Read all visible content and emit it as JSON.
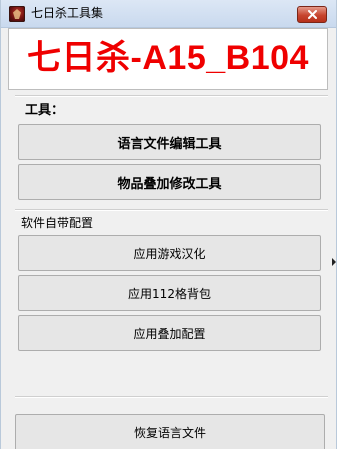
{
  "window": {
    "title": "七日杀工具集",
    "close_icon": "close-icon"
  },
  "header": {
    "title": "七日杀-A15_B104"
  },
  "tools_group": {
    "label": "工具：",
    "buttons": [
      {
        "label": "语言文件编辑工具"
      },
      {
        "label": "物品叠加修改工具"
      }
    ]
  },
  "builtin_group": {
    "label": "软件自带配置",
    "buttons": [
      {
        "label": "应用游戏汉化"
      },
      {
        "label": "应用112格背包"
      },
      {
        "label": "应用叠加配置"
      }
    ]
  },
  "footer": {
    "restore_label": "恢复语言文件"
  },
  "colors": {
    "header_title": "#ef0000",
    "titlebar": "#c9d9ee",
    "close_button": "#c7452f"
  }
}
